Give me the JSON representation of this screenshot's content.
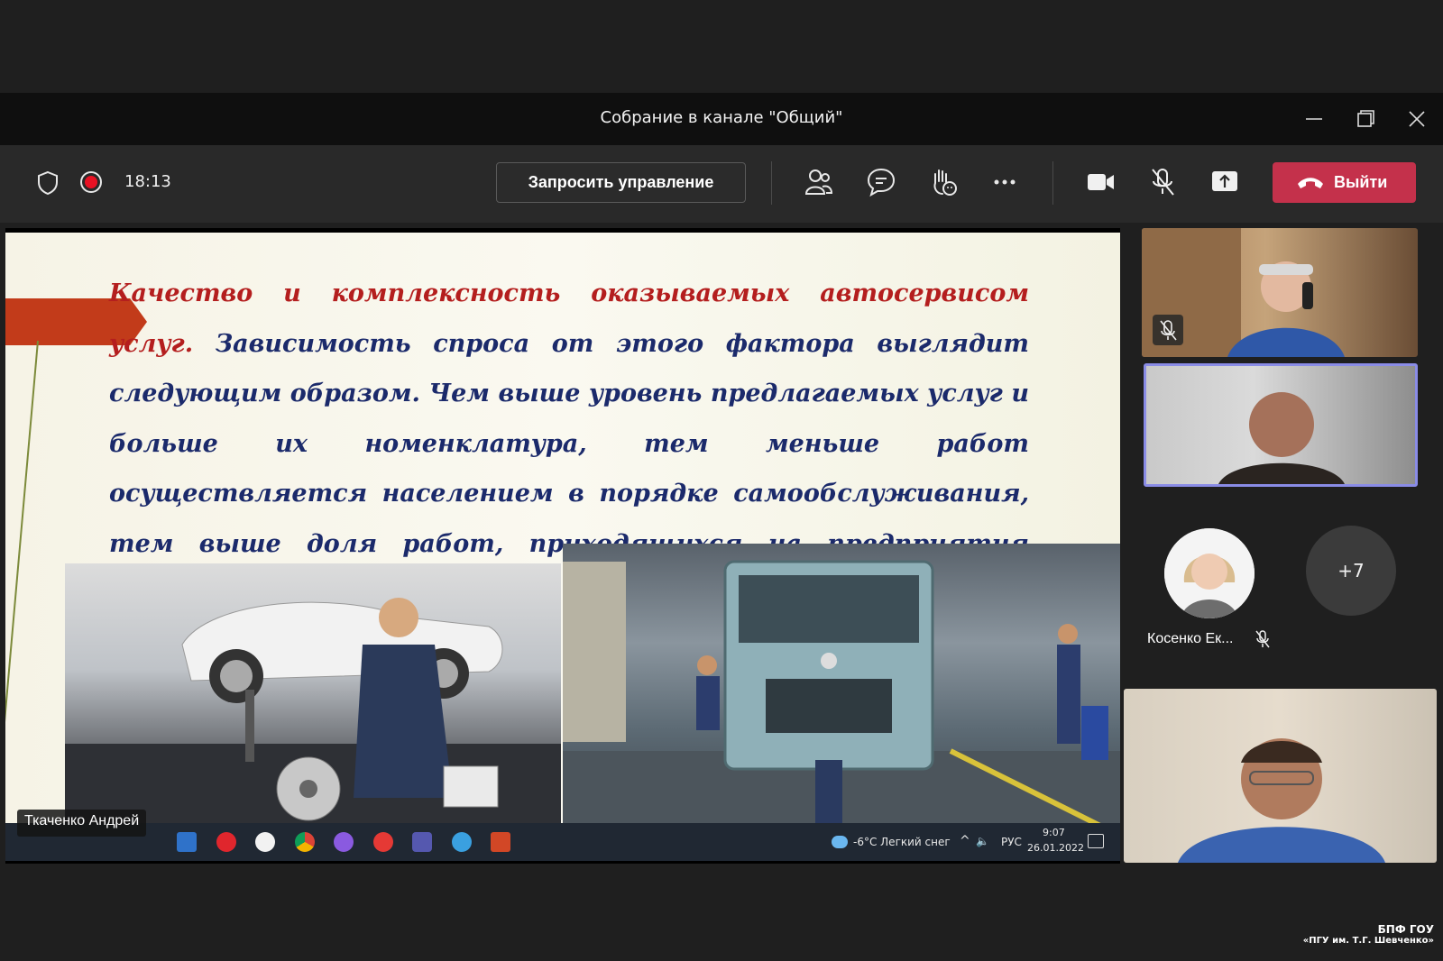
{
  "window": {
    "title": "Собрание в канале \"Общий\""
  },
  "toolbar": {
    "timer": "18:13",
    "request_control_label": "Запросить управление",
    "leave_label": "Выйти",
    "colors": {
      "leave": "#c4314b",
      "record": "#e81123"
    }
  },
  "slide": {
    "para_red": "Качество и комплексность оказываемых автосервисом услуг.",
    "para_blue": "Зависимость спроса от этого фактора выглядит следующим образом. Чем выше уровень предлагаемых услуг и больше их номенклатура, тем меньше работ осуществляется населением в порядке самообслуживания, тем выше доля работ, приходящихся на предприятия автосервиса."
  },
  "presenter": {
    "name": "Ткаченко Андрей"
  },
  "taskbar": {
    "weather": "-6°C  Легкий снег",
    "lang": "РУС",
    "time": "9:07",
    "date": "26.01.2022"
  },
  "participants": {
    "named": "Косенко Ек...",
    "overflow": "+7"
  },
  "watermark": {
    "line1": "БПФ ГОУ",
    "line2": "«ПГУ им. Т.Г. Шевченко»"
  }
}
